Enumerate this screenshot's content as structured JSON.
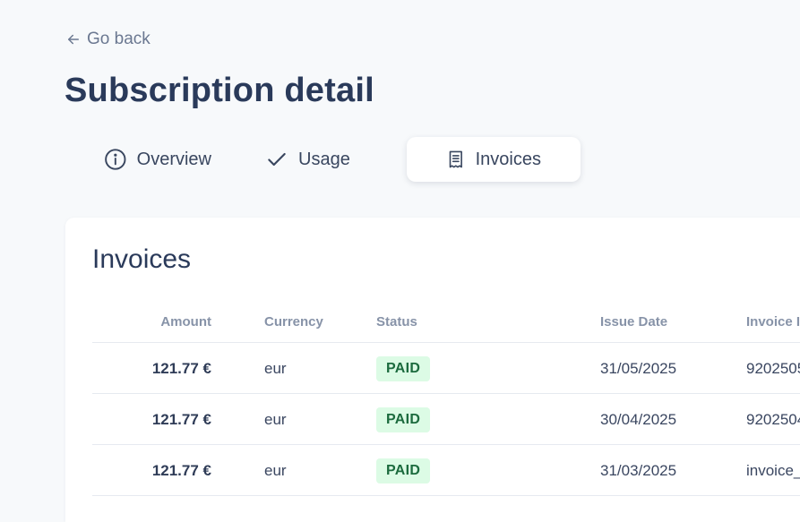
{
  "nav": {
    "back_label": "Go back"
  },
  "page": {
    "title": "Subscription detail"
  },
  "tabs": [
    {
      "label": "Overview",
      "icon": "info-icon",
      "active": false
    },
    {
      "label": "Usage",
      "icon": "check-icon",
      "active": false
    },
    {
      "label": "Invoices",
      "icon": "receipt-icon",
      "active": true
    }
  ],
  "invoices": {
    "title": "Invoices",
    "columns": [
      "Amount",
      "Currency",
      "Status",
      "Issue Date",
      "Invoice I"
    ],
    "rows": [
      {
        "amount": "121.77 €",
        "currency": "eur",
        "status": "PAID",
        "issue_date": "31/05/2025",
        "invoice_id": "9202505"
      },
      {
        "amount": "121.77 €",
        "currency": "eur",
        "status": "PAID",
        "issue_date": "30/04/2025",
        "invoice_id": "9202504"
      },
      {
        "amount": "121.77 €",
        "currency": "eur",
        "status": "PAID",
        "issue_date": "31/03/2025",
        "invoice_id": "invoice_"
      }
    ]
  },
  "colors": {
    "background": "#f7f9fb",
    "card": "#ffffff",
    "title": "#2a3a5a",
    "muted": "#6b7891",
    "paid_badge_bg": "#dcfbe5",
    "paid_badge_text": "#1c6b3e"
  }
}
